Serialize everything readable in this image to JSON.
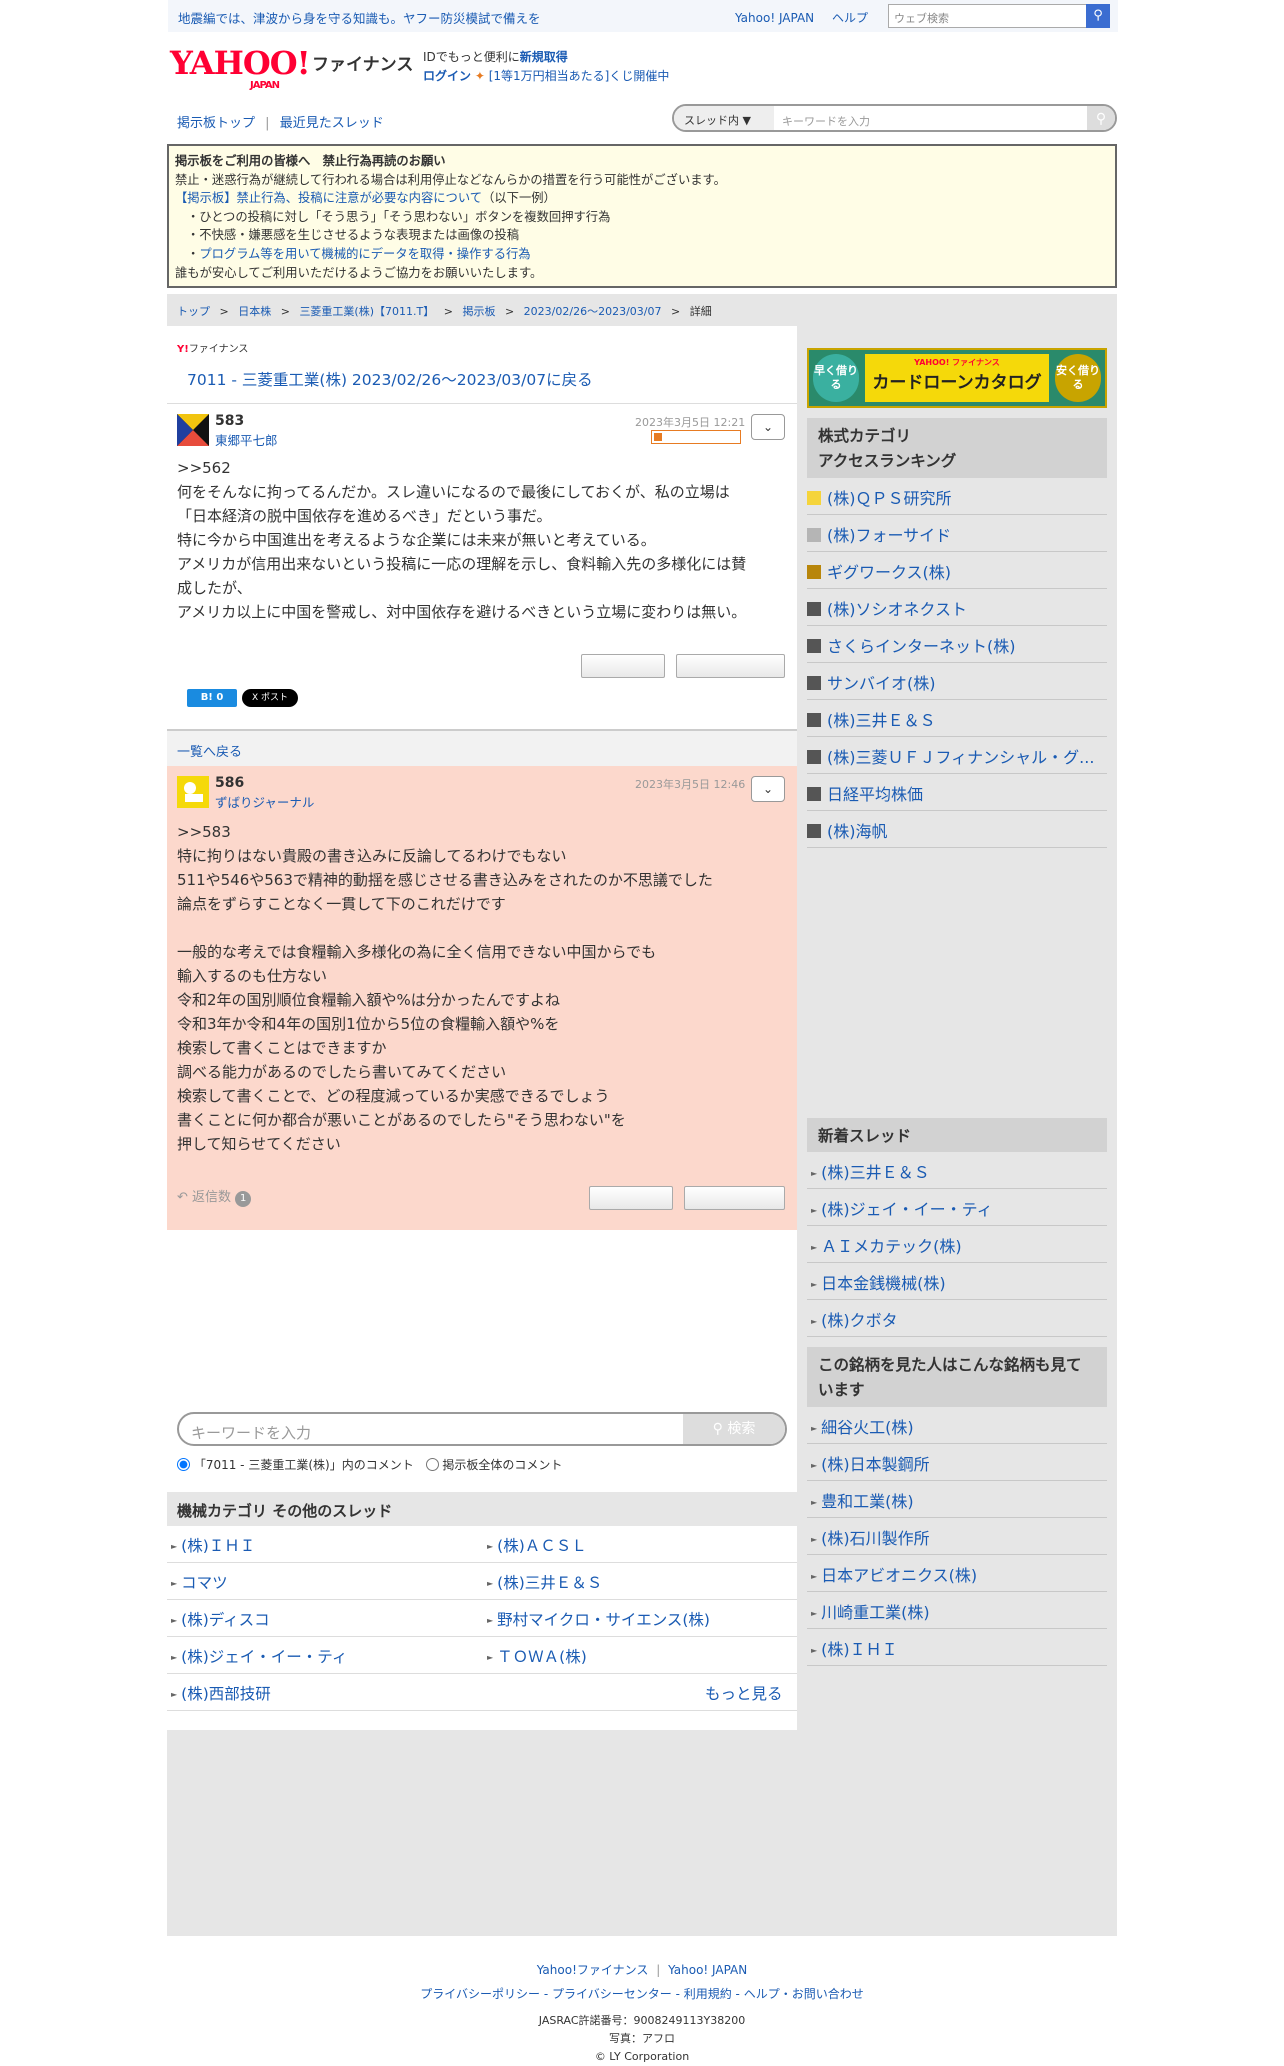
{
  "topbar": {
    "notice": "地震編では、津波から身を守る知識も。ヤフー防災模試で備えを",
    "links": [
      "Yahoo! JAPAN",
      "ヘルプ"
    ],
    "search_placeholder": "ウェブ検索"
  },
  "header": {
    "logo": "YAHOO!",
    "logo_sub": "JAPAN",
    "service": "ファイナンス",
    "id_text": "IDでもっと便利に",
    "id_link": "新規取得",
    "login": "ログイン",
    "lottery": "[1等1万円相当あたる]くじ開催中"
  },
  "nav": {
    "board_top": "掲示板トップ",
    "separator": "|",
    "recent": "最近見たスレッド",
    "search_scope": "スレッド内",
    "search_placeholder": "キーワードを入力"
  },
  "caution": {
    "title": "掲示板をご利用の皆様へ　禁止行為再読のお願い",
    "line1": "禁止・迷惑行為が継続して行われる場合は利用停止などなんらかの措置を行う可能性がございます。",
    "link": "【掲示板】禁止行為、投稿に注意が必要な内容について",
    "link_suffix": "（以下一例）",
    "items": [
      "・ひとつの投稿に対し「そう思う」「そう思わない」ボタンを複数回押す行為",
      "・不快感・嫌悪感を生じさせるような表現または画像の投稿"
    ],
    "item_link_prefix": "・",
    "item_link": "プログラム等を用いて機械的にデータを取得・操作する行為",
    "footer": "誰もが安心してご利用いただけるようご協力をお願いいたします。"
  },
  "breadcrumb": [
    "トップ",
    "日本株",
    "三菱重工業(株)【7011.T】",
    "掲示板",
    "2023/02/26〜2023/03/07",
    "詳細"
  ],
  "breadcrumb_sep": ">",
  "thread": {
    "logo": "Y!",
    "logo_text": "ファイナンス",
    "title": "7011 - 三菱重工業(株) 2023/02/26〜2023/03/07に戻る"
  },
  "post1": {
    "number": "583",
    "author": "東郷平七郎",
    "date": "2023年3月5日 12:21",
    "reply_to": ">>562",
    "lines": [
      "何をそんなに拘ってるんだか。スレ違いになるので最後にしておくが、私の立場は",
      "「日本経済の脱中国依存を進めるべき」だという事だ。",
      "特に今から中国進出を考えるような企業には未来が無いと考えている。",
      "アメリカが信用出来ないという投稿に一応の理解を示し、食料輸入先の多様化には賛",
      "成したが、",
      "アメリカ以上に中国を警戒し、対中国依存を避けるべきという立場に変わりは無い。"
    ],
    "hatena": "B! 0",
    "x_label": "X ポスト"
  },
  "back_to_list": "一覧へ戻る",
  "post2": {
    "number": "586",
    "author": "ずばりジャーナル",
    "date": "2023年3月5日 12:46",
    "lines": [
      ">>583",
      "特に拘りはない貴殿の書き込みに反論してるわけでもない",
      "511や546や563で精神的動揺を感じさせる書き込みをされたのか不思議でした",
      "論点をずらすことなく一貫して下のこれだけです",
      "",
      "一般的な考えでは食糧輸入多様化の為に全く信用できない中国からでも",
      "輸入するのも仕方ない",
      "令和2年の国別順位食糧輸入額や%は分かったんですよね",
      "令和3年か令和4年の国別1位から5位の食糧輸入額や%を",
      "検索して書くことはできますか",
      "調べる能力があるのでしたら書いてみてください",
      "検索して書くことで、どの程度減っているか実感できるでしょう",
      "書くことに何か都合が悪いことがあるのでしたら\"そう思わない\"を",
      "押して知らせてください"
    ],
    "reply_label": "返信数",
    "reply_count": "1"
  },
  "bottom_search": {
    "placeholder": "キーワードを入力",
    "button": "検索",
    "radio1": "「7011 - 三菱重工業(株)」内のコメント",
    "radio2": "掲示板全体のコメント"
  },
  "machine": {
    "heading": "機械カテゴリ その他のスレッド",
    "rows": [
      [
        "(株)ＩＨＩ",
        "(株)ＡＣＳＬ"
      ],
      [
        "コマツ",
        "(株)三井Ｅ＆Ｓ"
      ],
      [
        "(株)ディスコ",
        "野村マイクロ・サイエンス(株)"
      ],
      [
        "(株)ジェイ・イー・ティ",
        "ＴＯＷＡ(株)"
      ]
    ],
    "last": "(株)西部技研",
    "more": "もっと見る"
  },
  "sidebar": {
    "banner_left": "早く借りる",
    "banner_brand": "YAHOO! ファイナンス",
    "banner_main": "カードローンカタログ",
    "banner_right": "安く借りる",
    "ranking_heading1": "株式カテゴリ",
    "ranking_heading2": "アクセスランキング",
    "ranking": [
      "(株)ＱＰＳ研究所",
      "(株)フォーサイド",
      "ギグワークス(株)",
      "(株)ソシオネクスト",
      "さくらインターネット(株)",
      "サンバイオ(株)",
      "(株)三井Ｅ＆Ｓ",
      "(株)三菱ＵＦＪフィナンシャル・グ...",
      "日経平均株価",
      "(株)海帆"
    ],
    "rank_colors": [
      "#f5d43b",
      "#b5b5b5",
      "#b8860b",
      "#555555",
      "#555555",
      "#555555",
      "#555555",
      "#555555",
      "#555555",
      "#555555"
    ],
    "new_heading": "新着スレッド",
    "new_threads": [
      "(株)三井Ｅ＆Ｓ",
      "(株)ジェイ・イー・ティ",
      "ＡＩメカテック(株)",
      "日本金銭機械(株)",
      "(株)クボタ"
    ],
    "also_heading": "この銘柄を見た人はこんな銘柄も見ています",
    "also": [
      "細谷火工(株)",
      "(株)日本製鋼所",
      "豊和工業(株)",
      "(株)石川製作所",
      "日本アビオニクス(株)",
      "川崎重工業(株)",
      "(株)ＩＨＩ"
    ]
  },
  "footer": {
    "line1a": "Yahoo!ファイナンス",
    "line1sep": "|",
    "line1b": "Yahoo! JAPAN",
    "links": "プライバシーポリシー - プライバシーセンター - 利用規約 - ヘルプ・お問い合わせ",
    "jasrac": "JASRAC許諾番号：9008249113Y38200",
    "photo": "写真：アフロ",
    "copyright": "© LY Corporation"
  }
}
